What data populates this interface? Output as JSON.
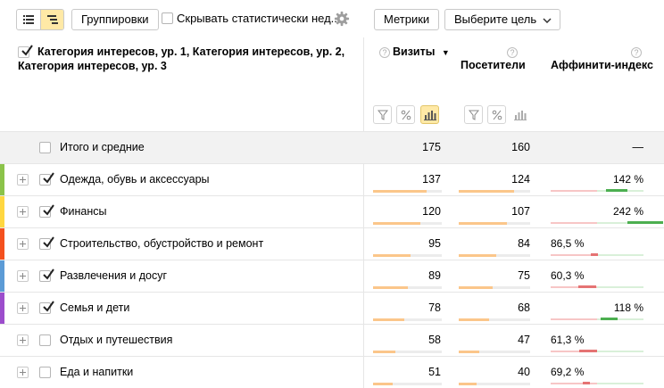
{
  "toolbar": {
    "groupings_label": "Группировки",
    "hide_stats_label": "Скрывать статистически нед...",
    "metrics_label": "Метрики",
    "goal_label": "Выберите цель"
  },
  "header": {
    "dimension_title": "Категория интересов, ур. 1, Категория интересов, ур. 2, Категория интересов, ур. 3",
    "visits": "Визиты",
    "visitors": "Посетители",
    "affinity": "Аффинити-индекс",
    "help_glyph": "?",
    "sort_glyph": "▼"
  },
  "totals": {
    "label": "Итого и средние",
    "visits": "175",
    "visitors": "160",
    "affinity": "—"
  },
  "rows": [
    {
      "label": "Одежда, обувь и аксессуары",
      "visits": "137",
      "visitors": "124",
      "affinity": "142 %",
      "affinity_value": 142,
      "visits_share": 0.78,
      "visitors_share": 0.78,
      "checked": true,
      "color": "#8bc34a"
    },
    {
      "label": "Финансы",
      "visits": "120",
      "visitors": "107",
      "affinity": "242 %",
      "affinity_value": 242,
      "visits_share": 0.69,
      "visitors_share": 0.67,
      "checked": true,
      "color": "#ffd740"
    },
    {
      "label": "Строительство, обустройство и ремонт",
      "visits": "95",
      "visitors": "84",
      "affinity": "86,5 %",
      "affinity_value": 86.5,
      "visits_share": 0.54,
      "visitors_share": 0.53,
      "checked": true,
      "color": "#f4511e"
    },
    {
      "label": "Развлечения и досуг",
      "visits": "89",
      "visitors": "75",
      "affinity": "60,3 %",
      "affinity_value": 60.3,
      "visits_share": 0.51,
      "visitors_share": 0.47,
      "checked": true,
      "color": "#5c9bd6"
    },
    {
      "label": "Семья и дети",
      "visits": "78",
      "visitors": "68",
      "affinity": "118 %",
      "affinity_value": 118,
      "visits_share": 0.45,
      "visitors_share": 0.43,
      "checked": true,
      "color": "#9c4dcc"
    },
    {
      "label": "Отдых и путешествия",
      "visits": "58",
      "visitors": "47",
      "affinity": "61,3 %",
      "affinity_value": 61.3,
      "visits_share": 0.33,
      "visitors_share": 0.29,
      "checked": false,
      "color": ""
    },
    {
      "label": "Еда и напитки",
      "visits": "51",
      "visitors": "40",
      "affinity": "69,2 %",
      "affinity_value": 69.2,
      "visits_share": 0.29,
      "visitors_share": 0.25,
      "checked": false,
      "color": ""
    }
  ],
  "colors": {
    "accent": "#ffe9a6",
    "bar": "#fbc68a",
    "positive": "#4caf50",
    "negative": "#e57373",
    "checkmark": "#222222"
  },
  "icons": [
    "list-view-icon",
    "tree-view-icon",
    "gear-icon",
    "chevron-down-icon",
    "filter-icon",
    "percent-icon",
    "bar-chart-icon",
    "expand-icon",
    "checkmark-icon"
  ]
}
